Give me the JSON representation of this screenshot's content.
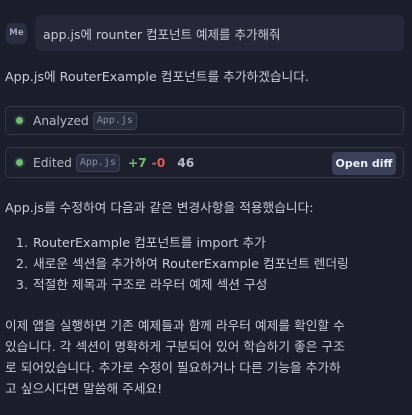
{
  "user_message": {
    "avatar_initials": "Me",
    "text": "app.js에 rounter 컴포넌트 예제를 추가해줘"
  },
  "assistant": {
    "intro": "App.js에 RouterExample 컴포넌트를 추가하겠습니다.",
    "analyzed": {
      "label": "Analyzed",
      "file": "App.js",
      "status_color": "#6fbf73"
    },
    "edited": {
      "label": "Edited",
      "file": "App.js",
      "additions": "+7",
      "deletions": "-0",
      "total": "46",
      "open_diff_label": "Open diff",
      "status_color": "#6fbf73"
    },
    "summary": "App.js를 수정하여 다음과 같은 변경사항을 적용했습니다:",
    "steps": [
      {
        "num": "1.",
        "text": "RouterExample 컴포넌트를 import 추가"
      },
      {
        "num": "2.",
        "text": "새로운 섹션을 추가하여 RouterExample 컴포넌트 렌더링"
      },
      {
        "num": "3.",
        "text": "적절한 제목과 구조로 라우터 예제 섹션 구성"
      }
    ],
    "closing_lines": [
      "이제 앱을 실행하면 기존 예제들과 함께 라우터 예제를 확인할 수",
      "있습니다. 각 섹션이 명확하게 구분되어 있어 학습하기 좋은 구조",
      "로 되어있습니다. 추가로 수정이 필요하거나 다른 기능을 추가하",
      "고 싶으시다면 말씀해 주세요!"
    ]
  },
  "colors": {
    "background": "#1c1e2c",
    "additions": "#6fbf73",
    "deletions": "#e05a5a"
  }
}
